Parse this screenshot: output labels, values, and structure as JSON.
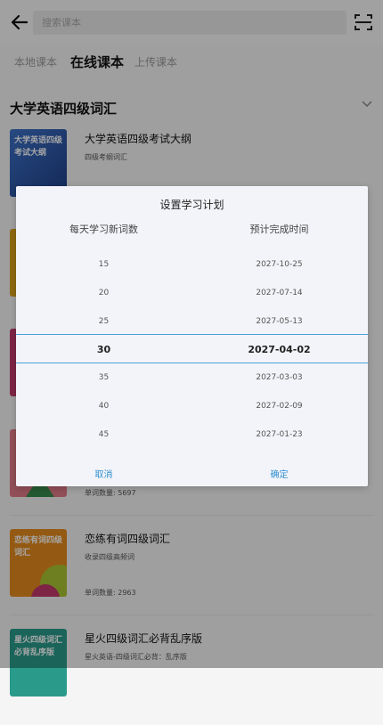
{
  "header": {
    "search_placeholder": "搜索课本",
    "back_icon": "arrow-left-icon",
    "scan_icon": "scan-icon"
  },
  "tabs": [
    {
      "label": "本地课本",
      "active": false
    },
    {
      "label": "在线课本",
      "active": true
    },
    {
      "label": "上传课本",
      "active": false
    }
  ],
  "section": {
    "title": "大学英语四级词汇"
  },
  "books": [
    {
      "cover_text": "大学英语四级考试大纲",
      "name": "大学英语四级考试大纲",
      "desc": "四级考纲词汇",
      "count": "",
      "cover_color": "#2c5aa8"
    },
    {
      "cover_text": "",
      "name": "",
      "desc": "",
      "count": "",
      "cover_color": "#d9a21b"
    },
    {
      "cover_text": "",
      "name": "",
      "desc": "",
      "count": "",
      "cover_color": "#c23a6a"
    },
    {
      "cover_text": "",
      "name": "",
      "desc": "",
      "count": "单词数量: 5697",
      "cover_color": "#d85a70"
    },
    {
      "cover_text": "恋练有词四级词汇",
      "name": "恋练有词四级词汇",
      "desc": "收录四级高频词",
      "count": "单词数量: 2963",
      "cover_color": "#e38a1e"
    },
    {
      "cover_text": "星火四级词汇必背乱序版",
      "name": "星火四级词汇必背乱序版",
      "desc": "星火英语-四级词汇必背：乱序版",
      "count": "",
      "cover_color": "#2a9a8a"
    }
  ],
  "dialog": {
    "title": "设置学习计划",
    "col_left": "每天学习新词数",
    "col_right": "预计完成时间",
    "rows": [
      {
        "words": "15",
        "date": "2027-10-25"
      },
      {
        "words": "20",
        "date": "2027-07-14"
      },
      {
        "words": "25",
        "date": "2027-05-13"
      },
      {
        "words": "30",
        "date": "2027-04-02"
      },
      {
        "words": "35",
        "date": "2027-03-03"
      },
      {
        "words": "40",
        "date": "2027-02-09"
      },
      {
        "words": "45",
        "date": "2027-01-23"
      }
    ],
    "selected_index": 3,
    "cancel": "取消",
    "confirm": "确定",
    "accent_color": "#2f8fd1"
  }
}
